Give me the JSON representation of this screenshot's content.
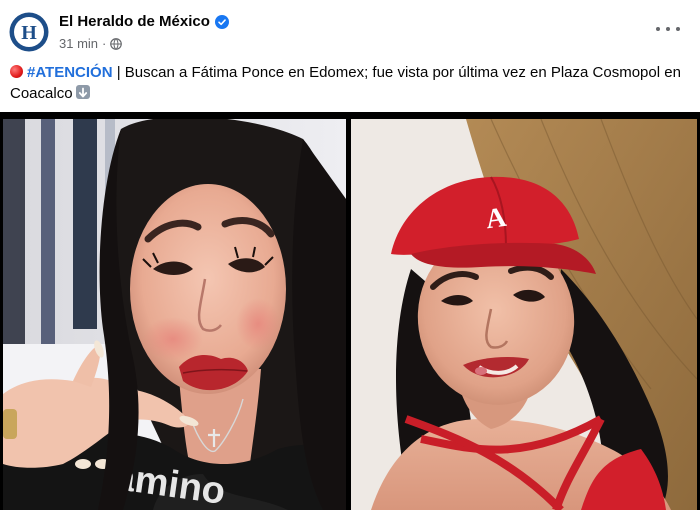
{
  "post": {
    "page_name": "El Heraldo de México",
    "avatar_letter": "H",
    "time": "31 min",
    "separator": "·",
    "text": {
      "hashtag": "#ATENCIÓN",
      "body": " | Buscan a Fátima Ponce en Edomex; fue vista por última vez en Plaza Cosmopol en Coacalco"
    }
  },
  "colors": {
    "accent": "#216fdb",
    "brand_blue": "#1d4e89",
    "verified": "#1877f2",
    "cap_red": "#d21f2b"
  },
  "icons": {
    "verified": "verified-badge-icon",
    "privacy": "globe-icon",
    "more": "more-options-icon",
    "alert": "red-circle-emoji",
    "down": "down-arrow-emoji"
  },
  "photos": {
    "left_shirt_text": "amino",
    "right_cap_text": "A"
  }
}
